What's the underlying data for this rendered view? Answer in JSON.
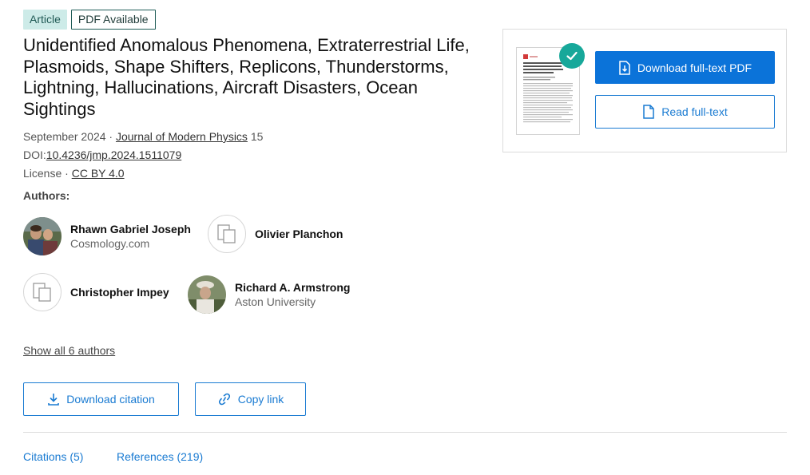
{
  "badges": {
    "article": "Article",
    "pdf": "PDF Available"
  },
  "title": "Unidentified Anomalous Phenomena, Extraterrestrial Life, Plasmoids, Shape Shifters, Replicons, Thunderstorms, Lightning, Hallucinations, Aircraft Disasters, Ocean Sightings",
  "meta": {
    "date": "September 2024 · ",
    "journal": "Journal of Modern Physics",
    "volume": " 15",
    "doi_label": "DOI:",
    "doi": "10.4236/jmp.2024.1511079",
    "license_label": "License · ",
    "license": "CC BY 4.0"
  },
  "authors_label": "Authors:",
  "authors": [
    {
      "name": "Rhawn Gabriel Joseph",
      "affiliation": "Cosmology.com",
      "avatar": "photo"
    },
    {
      "name": "Olivier Planchon",
      "affiliation": "",
      "avatar": "placeholder-icon"
    },
    {
      "name": "Christopher Impey",
      "affiliation": "",
      "avatar": "placeholder-icon"
    },
    {
      "name": "Richard A. Armstrong",
      "affiliation": "Aston University",
      "avatar": "photo"
    }
  ],
  "show_all": "Show all 6 authors",
  "actions": {
    "download_citation": "Download citation",
    "copy_link": "Copy link"
  },
  "tabs": {
    "citations": "Citations (5)",
    "references": "References (219)"
  },
  "pdf_card": {
    "download_pdf": "Download full-text PDF",
    "read_fulltext": "Read full-text"
  },
  "colors": {
    "accent": "#1a7bd2",
    "primary_button": "#0b73d9",
    "badge_bg": "#cdebe8",
    "check": "#17a89a"
  }
}
